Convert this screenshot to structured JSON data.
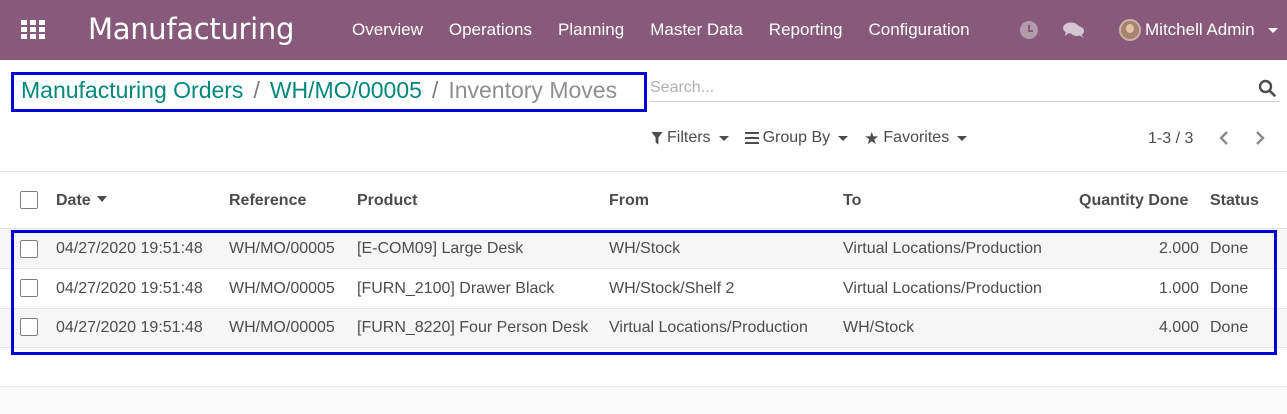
{
  "navbar": {
    "apps_icon": "apps-grid-icon",
    "brand": "Manufacturing",
    "menu": [
      "Overview",
      "Operations",
      "Planning",
      "Master Data",
      "Reporting",
      "Configuration"
    ],
    "activity_icon": "clock-icon",
    "messaging_icon": "chat-icon",
    "user_name": "Mitchell Admin",
    "color": "#875a7b"
  },
  "breadcrumb": {
    "items": [
      "Manufacturing Orders",
      "WH/MO/00005"
    ],
    "separator": "/",
    "current": "Inventory Moves"
  },
  "search": {
    "placeholder": "Search...",
    "value": ""
  },
  "filters": {
    "filters_label": "Filters",
    "group_by_label": "Group By",
    "favorites_label": "Favorites"
  },
  "pager": {
    "value": "1-3 / 3"
  },
  "table": {
    "columns": [
      "Date",
      "Reference",
      "Product",
      "From",
      "To",
      "Quantity Done",
      "Status"
    ],
    "sorted_column": "Date",
    "rows": [
      [
        "04/27/2020 19:51:48",
        "WH/MO/00005",
        "[E-COM09] Large Desk",
        "WH/Stock",
        "Virtual Locations/Production",
        "2.000",
        "Done"
      ],
      [
        "04/27/2020 19:51:48",
        "WH/MO/00005",
        "[FURN_2100] Drawer Black",
        "WH/Stock/Shelf 2",
        "Virtual Locations/Production",
        "1.000",
        "Done"
      ],
      [
        "04/27/2020 19:51:48",
        "WH/MO/00005",
        "[FURN_8220] Four Person Desk",
        "Virtual Locations/Production",
        "WH/Stock",
        "4.000",
        "Done"
      ]
    ]
  },
  "colors": {
    "accent": "#00897b",
    "highlight_box": "#0000d9"
  }
}
